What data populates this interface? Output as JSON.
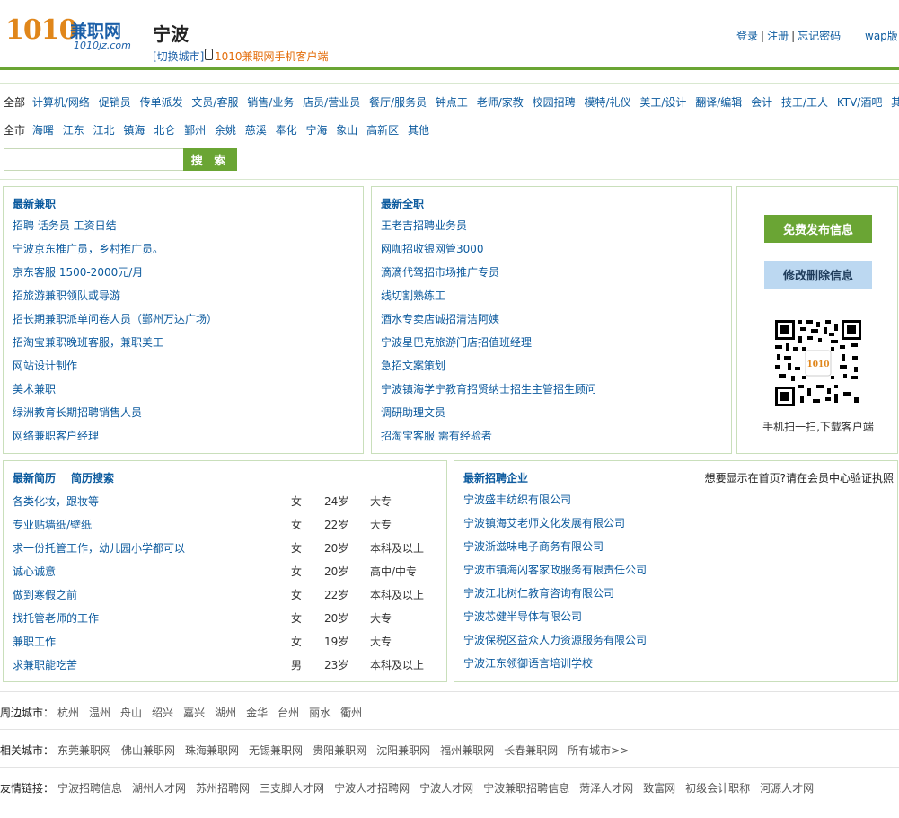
{
  "header": {
    "logo_number": "1010",
    "logo_text": "兼职网",
    "logo_domain": "1010jz.com",
    "city": "宁波",
    "switch_city": "[切换城市]",
    "app_link": "1010兼职网手机客户端",
    "login": "登录",
    "register": "注册",
    "forgot": "忘记密码",
    "wap": "wap版"
  },
  "filters": {
    "category_lead": "全部",
    "categories": [
      "计算机/网络",
      "促销员",
      "传单派发",
      "文员/客服",
      "销售/业务",
      "店员/营业员",
      "餐厅/服务员",
      "钟点工",
      "老师/家教",
      "校园招聘",
      "模特/礼仪",
      "美工/设计",
      "翻译/编辑",
      "会计",
      "技工/工人",
      "KTV/酒吧",
      "其他"
    ],
    "area_lead": "全市",
    "areas": [
      "海曙",
      "江东",
      "江北",
      "镇海",
      "北仑",
      "鄞州",
      "余姚",
      "慈溪",
      "奉化",
      "宁海",
      "象山",
      "高新区",
      "其他"
    ],
    "search_placeholder": "",
    "search_button": "搜 索"
  },
  "latest_parttime": {
    "title": "最新兼职",
    "items": [
      "招聘 话务员 工资日结",
      "宁波京东推广员，乡村推广员。",
      "京东客服 1500-2000元/月",
      "招旅游兼职领队或导游",
      "招长期兼职派单问卷人员（鄞州万达广场）",
      "招淘宝兼职晚班客服，兼职美工",
      "网站设计制作",
      "美术兼职",
      "绿洲教育长期招聘销售人员",
      "网络兼职客户经理"
    ]
  },
  "latest_fulltime": {
    "title": "最新全职",
    "items": [
      "王老吉招聘业务员",
      "网咖招收银网管3000",
      "滴滴代驾招市场推广专员",
      "线切割熟练工",
      "酒水专卖店诚招清洁阿姨",
      "宁波星巴克旅游门店招值班经理",
      "急招文案策划",
      "宁波镇海学宁教育招贤纳士招生主管招生顾问",
      "调研助理文员",
      "招淘宝客服 需有经验者"
    ]
  },
  "side": {
    "publish": "免费发布信息",
    "edit": "修改删除信息",
    "qr_caption": "手机扫一扫,下载客户端"
  },
  "resumes": {
    "title": "最新简历",
    "search_title": "简历搜索",
    "rows": [
      {
        "title": "各类化妆，跟妆等",
        "sex": "女",
        "age": "24岁",
        "edu": "大专"
      },
      {
        "title": "专业贴墙纸/壁纸",
        "sex": "女",
        "age": "22岁",
        "edu": "大专"
      },
      {
        "title": "求一份托管工作，幼儿园小学都可以",
        "sex": "女",
        "age": "20岁",
        "edu": "本科及以上"
      },
      {
        "title": "诚心诚意",
        "sex": "女",
        "age": "20岁",
        "edu": "高中/中专"
      },
      {
        "title": "做到寒假之前",
        "sex": "女",
        "age": "22岁",
        "edu": "本科及以上"
      },
      {
        "title": "找托管老师的工作",
        "sex": "女",
        "age": "20岁",
        "edu": "大专"
      },
      {
        "title": "兼职工作",
        "sex": "女",
        "age": "19岁",
        "edu": "大专"
      },
      {
        "title": "求兼职能吃苦",
        "sex": "男",
        "age": "23岁",
        "edu": "本科及以上"
      }
    ]
  },
  "companies": {
    "title": "最新招聘企业",
    "note": "想要显示在首页?请在会员中心验证执照",
    "items": [
      "宁波盛丰纺织有限公司",
      "宁波镇海艾老师文化发展有限公司",
      "宁波浙滋味电子商务有限公司",
      "宁波市镇海闪客家政服务有限责任公司",
      "宁波江北树仁教育咨询有限公司",
      "宁波芯健半导体有限公司",
      "宁波保税区益众人力资源服务有限公司",
      "宁波江东领御语言培训学校"
    ]
  },
  "footer": {
    "near_label": "周边城市：",
    "near": [
      "杭州",
      "温州",
      "舟山",
      "绍兴",
      "嘉兴",
      "湖州",
      "金华",
      "台州",
      "丽水",
      "衢州"
    ],
    "related_label": "相关城市：",
    "related": [
      "东莞兼职网",
      "佛山兼职网",
      "珠海兼职网",
      "无锡兼职网",
      "贵阳兼职网",
      "沈阳兼职网",
      "福州兼职网",
      "长春兼职网",
      "所有城市>>"
    ],
    "friends_label": "友情链接：",
    "friends": [
      "宁波招聘信息",
      "湖州人才网",
      "苏州招聘网",
      "三支脚人才网",
      "宁波人才招聘网",
      "宁波人才网",
      "宁波兼职招聘信息",
      "菏泽人才网",
      "致富网",
      "初级会计职称",
      "河源人才网"
    ]
  }
}
